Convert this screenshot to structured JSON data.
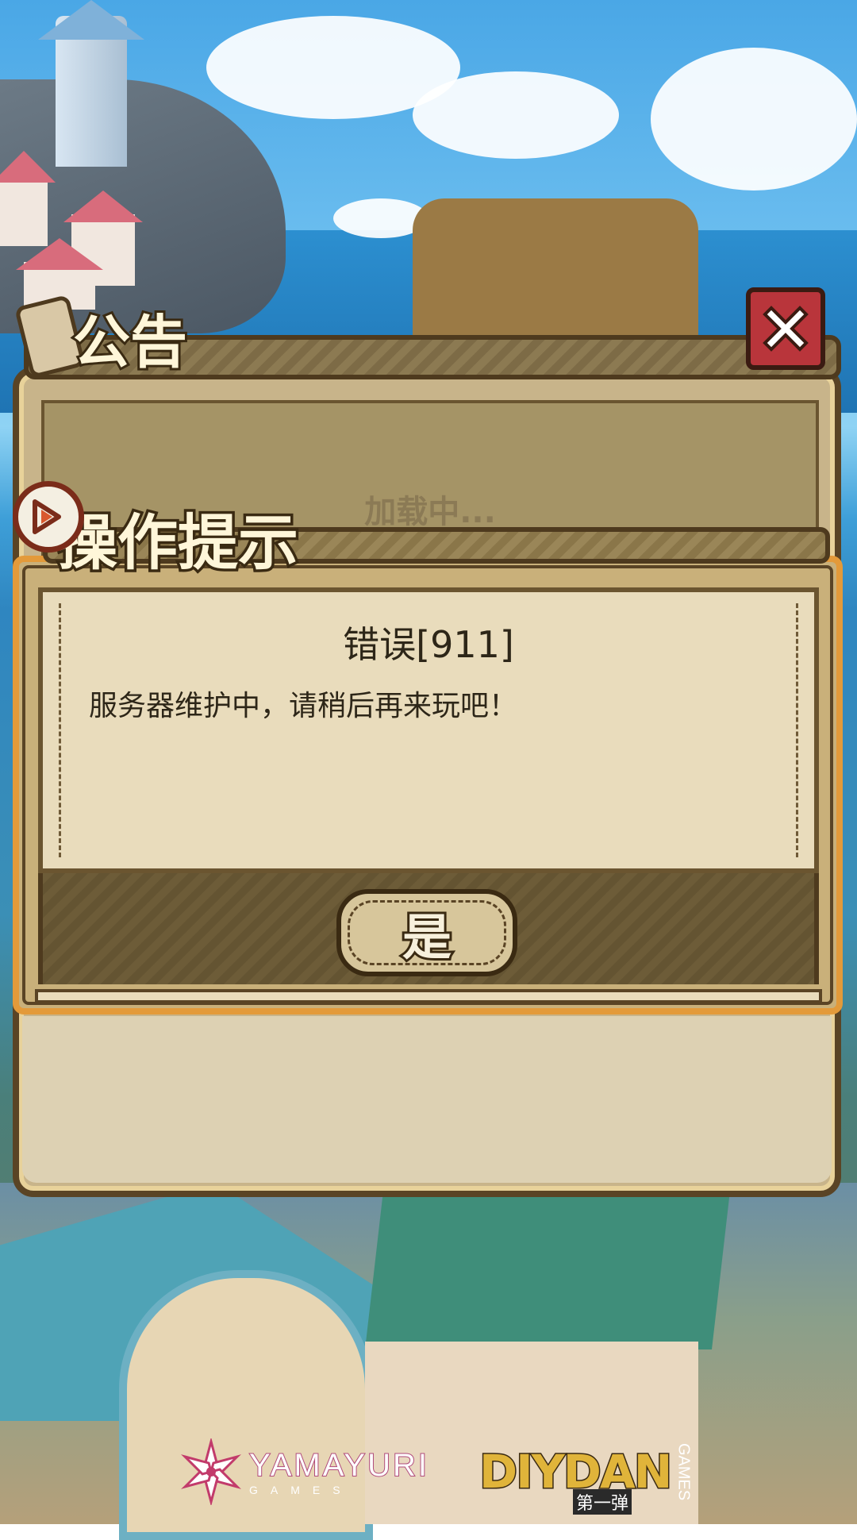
{
  "announcement": {
    "title": "公告",
    "loading_text": "加载中...",
    "close_icon": "close-x-icon"
  },
  "dialog": {
    "title": "操作提示",
    "heading": "错误[911]",
    "message": "服务器维护中，请稍后再来玩吧！",
    "confirm_label": "是"
  },
  "footer": {
    "logo_left": {
      "name": "YAMAYURI",
      "sub": "GAMES"
    },
    "logo_right": {
      "name": "DIYDAN",
      "cn": "第一弹",
      "sub": "GAMES"
    }
  },
  "colors": {
    "close_button": "#b9353b",
    "dialog_border": "#e39a3a",
    "panel_parchment": "#e9dcbc",
    "text_dark": "#2d2618"
  }
}
